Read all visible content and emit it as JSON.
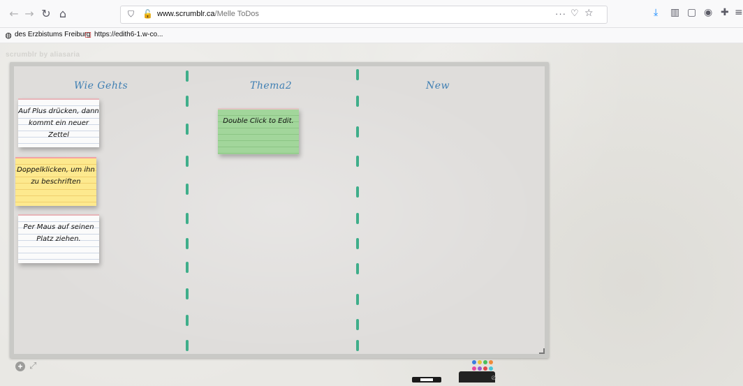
{
  "browser": {
    "nav": {
      "back_icon": "back-arrow-icon",
      "forward_icon": "forward-arrow-icon",
      "reload_icon": "reload-icon",
      "home_icon": "home-icon"
    },
    "url": {
      "host": "www.scrumblr.ca",
      "path": "/Melle ToDos"
    },
    "bookmarks": [
      {
        "label": "des Erzbistums Freiburg"
      },
      {
        "label": "https://edith6-1.w-co..."
      }
    ]
  },
  "page": {
    "brand": "scrumblr by aliasaria",
    "columns": [
      {
        "title": "Wie Gehts"
      },
      {
        "title": "Thema2"
      },
      {
        "title": "New"
      }
    ],
    "stickies": [
      {
        "text": "Auf Plus drücken, dann kommt ein neuer Zettel",
        "color": "white"
      },
      {
        "text": "Doppelklicken, um ihn zu beschriften",
        "color": "yellow"
      },
      {
        "text": "Per Maus auf seinen Platz ziehen.",
        "color": "white"
      },
      {
        "text": "Double Click to Edit.",
        "color": "green"
      }
    ],
    "palette": {
      "colors": [
        "#3b7ce0",
        "#e8c23a",
        "#4bbf5a",
        "#f08a3a",
        "#e84aa0",
        "#9b59d0",
        "#e04a4a",
        "#4ac6d8"
      ]
    }
  },
  "colors": {
    "divider": "#3fae8a",
    "column_title": "#3f7fb3"
  }
}
